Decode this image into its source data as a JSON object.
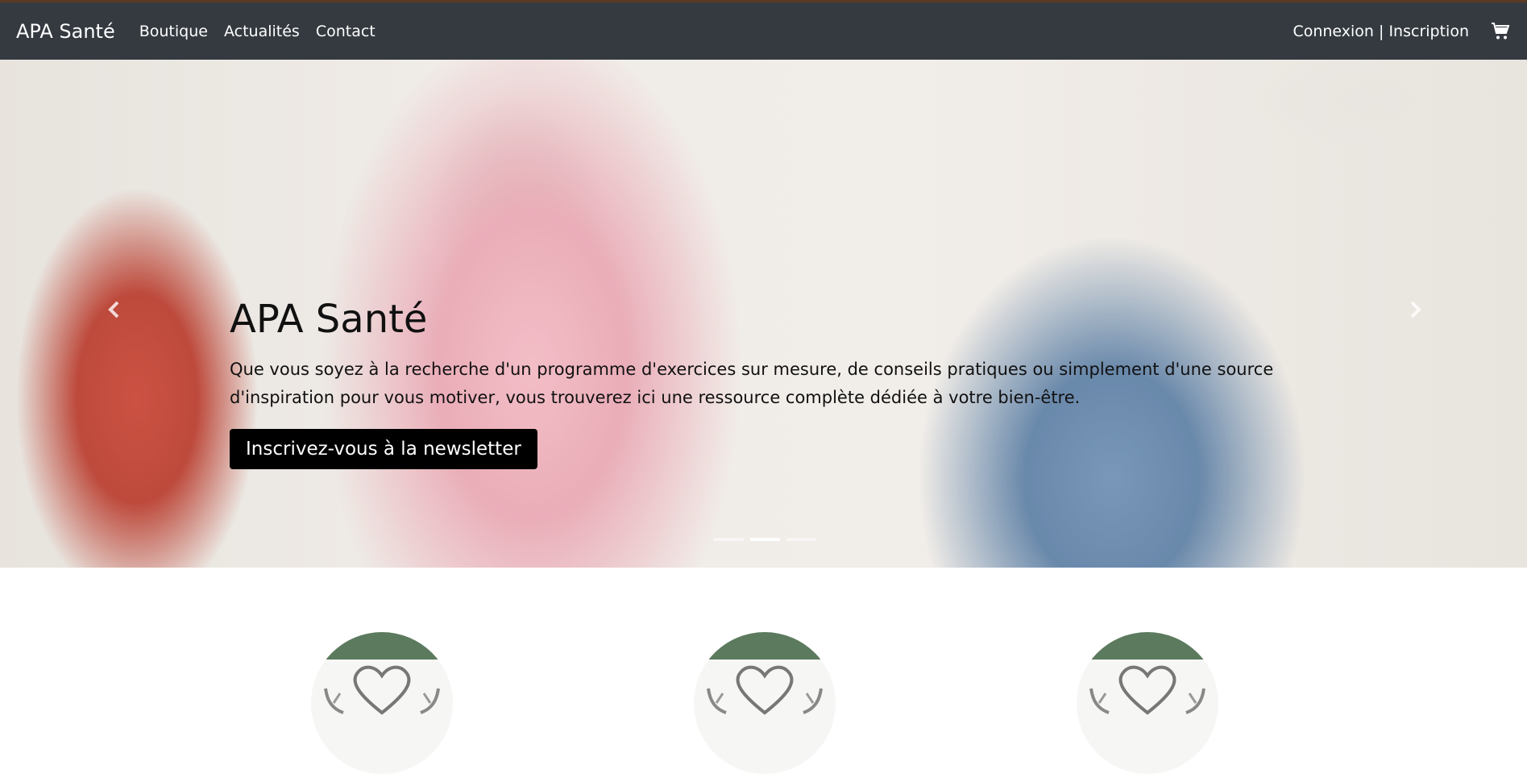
{
  "navbar": {
    "brand": "APA Santé",
    "links": [
      "Boutique",
      "Actualités",
      "Contact"
    ],
    "auth": "Connexion | Inscription",
    "cart_icon": "cart-icon"
  },
  "hero": {
    "title": "APA Santé",
    "text": "Que vous soyez à la recherche d'un programme d'exercices sur mesure, de conseils pratiques ou simplement d'une source d'inspiration pour vous motiver, vous trouverez ici une ressource complète dédiée à votre bien-être.",
    "cta": "Inscrivez-vous à la newsletter",
    "slides": 3,
    "active_slide": 2
  },
  "features": {
    "icon": "heart-in-hands-icon",
    "count": 3
  },
  "colors": {
    "navbar": "#343a40",
    "top_border": "#5b3a23",
    "cta_bg": "#000000",
    "feature_band": "#5c7a5e"
  }
}
